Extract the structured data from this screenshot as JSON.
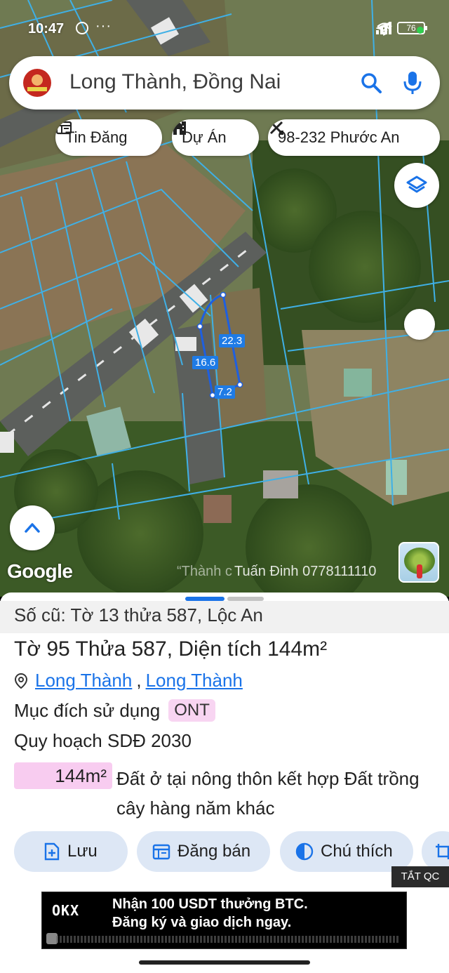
{
  "status": {
    "time": "10:47",
    "dots": "···",
    "battery": "76"
  },
  "search": {
    "text": "Long Thành, Đồng Nai"
  },
  "chips": {
    "news": "Tin Đăng",
    "project": "Dự Án",
    "parcel": "98-232 Phước An"
  },
  "map": {
    "dimensions": {
      "side_a": "22.3",
      "side_b": "16.6",
      "side_c": "7.2"
    },
    "brand": "Google",
    "watermark_a": "“Thành c",
    "watermark_b": "Tuấn Đinh 0778111110"
  },
  "sheet": {
    "old_ref": "Số cũ: Tờ 13 thửa 587, Lộc An",
    "title_prefix": "Tờ ",
    "sheet_no": "95",
    "title_mid": " Thửa ",
    "parcel_no": "587",
    "title_suffix": ", Diện tích ",
    "area": "144m²",
    "location_a": "Long Thành",
    "location_sep": ",",
    "location_b": "Long Thành",
    "purpose_label": "Mục đích sử dụng",
    "purpose_code": "ONT",
    "plan_label": "Quy hoạch SDĐ 2030",
    "plan_area": "144m²",
    "plan_desc": "Đất ở tại nông thôn kết hợp Đất trồng cây hàng năm khác"
  },
  "actions": {
    "save": "Lưu",
    "post": "Đăng bán",
    "legend": "Chú thích"
  },
  "ad": {
    "close": "TẮT QC",
    "brand": "OKX",
    "line1": "Nhận 100 USDT thưởng BTC.",
    "line2": "Đăng ký và giao dịch ngay."
  },
  "colors": {
    "accent": "#1a73e8",
    "badge": "#f8d5f2",
    "chip_bg": "#dde7f5"
  }
}
